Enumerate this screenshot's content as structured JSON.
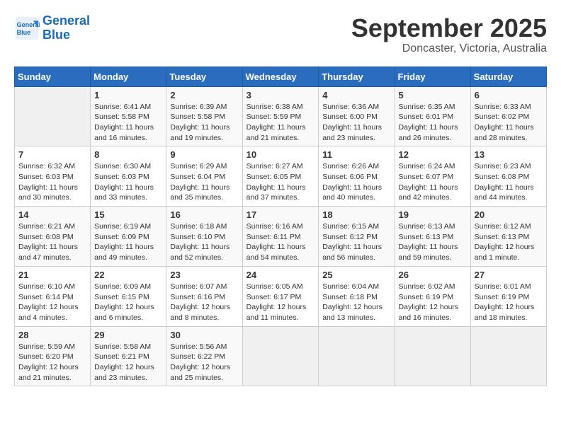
{
  "header": {
    "logo_line1": "General",
    "logo_line2": "Blue",
    "month": "September 2025",
    "location": "Doncaster, Victoria, Australia"
  },
  "weekdays": [
    "Sunday",
    "Monday",
    "Tuesday",
    "Wednesday",
    "Thursday",
    "Friday",
    "Saturday"
  ],
  "weeks": [
    [
      {
        "day": "",
        "info": ""
      },
      {
        "day": "1",
        "info": "Sunrise: 6:41 AM\nSunset: 5:58 PM\nDaylight: 11 hours\nand 16 minutes."
      },
      {
        "day": "2",
        "info": "Sunrise: 6:39 AM\nSunset: 5:58 PM\nDaylight: 11 hours\nand 19 minutes."
      },
      {
        "day": "3",
        "info": "Sunrise: 6:38 AM\nSunset: 5:59 PM\nDaylight: 11 hours\nand 21 minutes."
      },
      {
        "day": "4",
        "info": "Sunrise: 6:36 AM\nSunset: 6:00 PM\nDaylight: 11 hours\nand 23 minutes."
      },
      {
        "day": "5",
        "info": "Sunrise: 6:35 AM\nSunset: 6:01 PM\nDaylight: 11 hours\nand 26 minutes."
      },
      {
        "day": "6",
        "info": "Sunrise: 6:33 AM\nSunset: 6:02 PM\nDaylight: 11 hours\nand 28 minutes."
      }
    ],
    [
      {
        "day": "7",
        "info": "Sunrise: 6:32 AM\nSunset: 6:03 PM\nDaylight: 11 hours\nand 30 minutes."
      },
      {
        "day": "8",
        "info": "Sunrise: 6:30 AM\nSunset: 6:03 PM\nDaylight: 11 hours\nand 33 minutes."
      },
      {
        "day": "9",
        "info": "Sunrise: 6:29 AM\nSunset: 6:04 PM\nDaylight: 11 hours\nand 35 minutes."
      },
      {
        "day": "10",
        "info": "Sunrise: 6:27 AM\nSunset: 6:05 PM\nDaylight: 11 hours\nand 37 minutes."
      },
      {
        "day": "11",
        "info": "Sunrise: 6:26 AM\nSunset: 6:06 PM\nDaylight: 11 hours\nand 40 minutes."
      },
      {
        "day": "12",
        "info": "Sunrise: 6:24 AM\nSunset: 6:07 PM\nDaylight: 11 hours\nand 42 minutes."
      },
      {
        "day": "13",
        "info": "Sunrise: 6:23 AM\nSunset: 6:08 PM\nDaylight: 11 hours\nand 44 minutes."
      }
    ],
    [
      {
        "day": "14",
        "info": "Sunrise: 6:21 AM\nSunset: 6:08 PM\nDaylight: 11 hours\nand 47 minutes."
      },
      {
        "day": "15",
        "info": "Sunrise: 6:19 AM\nSunset: 6:09 PM\nDaylight: 11 hours\nand 49 minutes."
      },
      {
        "day": "16",
        "info": "Sunrise: 6:18 AM\nSunset: 6:10 PM\nDaylight: 11 hours\nand 52 minutes."
      },
      {
        "day": "17",
        "info": "Sunrise: 6:16 AM\nSunset: 6:11 PM\nDaylight: 11 hours\nand 54 minutes."
      },
      {
        "day": "18",
        "info": "Sunrise: 6:15 AM\nSunset: 6:12 PM\nDaylight: 11 hours\nand 56 minutes."
      },
      {
        "day": "19",
        "info": "Sunrise: 6:13 AM\nSunset: 6:13 PM\nDaylight: 11 hours\nand 59 minutes."
      },
      {
        "day": "20",
        "info": "Sunrise: 6:12 AM\nSunset: 6:13 PM\nDaylight: 12 hours\nand 1 minute."
      }
    ],
    [
      {
        "day": "21",
        "info": "Sunrise: 6:10 AM\nSunset: 6:14 PM\nDaylight: 12 hours\nand 4 minutes."
      },
      {
        "day": "22",
        "info": "Sunrise: 6:09 AM\nSunset: 6:15 PM\nDaylight: 12 hours\nand 6 minutes."
      },
      {
        "day": "23",
        "info": "Sunrise: 6:07 AM\nSunset: 6:16 PM\nDaylight: 12 hours\nand 8 minutes."
      },
      {
        "day": "24",
        "info": "Sunrise: 6:05 AM\nSunset: 6:17 PM\nDaylight: 12 hours\nand 11 minutes."
      },
      {
        "day": "25",
        "info": "Sunrise: 6:04 AM\nSunset: 6:18 PM\nDaylight: 12 hours\nand 13 minutes."
      },
      {
        "day": "26",
        "info": "Sunrise: 6:02 AM\nSunset: 6:19 PM\nDaylight: 12 hours\nand 16 minutes."
      },
      {
        "day": "27",
        "info": "Sunrise: 6:01 AM\nSunset: 6:19 PM\nDaylight: 12 hours\nand 18 minutes."
      }
    ],
    [
      {
        "day": "28",
        "info": "Sunrise: 5:59 AM\nSunset: 6:20 PM\nDaylight: 12 hours\nand 21 minutes."
      },
      {
        "day": "29",
        "info": "Sunrise: 5:58 AM\nSunset: 6:21 PM\nDaylight: 12 hours\nand 23 minutes."
      },
      {
        "day": "30",
        "info": "Sunrise: 5:56 AM\nSunset: 6:22 PM\nDaylight: 12 hours\nand 25 minutes."
      },
      {
        "day": "",
        "info": ""
      },
      {
        "day": "",
        "info": ""
      },
      {
        "day": "",
        "info": ""
      },
      {
        "day": "",
        "info": ""
      }
    ]
  ]
}
